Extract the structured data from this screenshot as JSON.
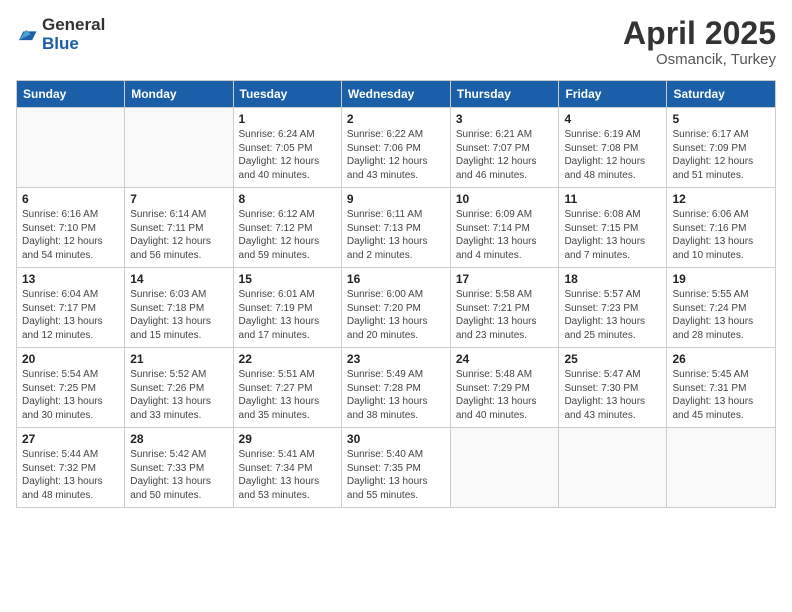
{
  "header": {
    "logo_general": "General",
    "logo_blue": "Blue",
    "title": "April 2025",
    "subtitle": "Osmancik, Turkey"
  },
  "days_of_week": [
    "Sunday",
    "Monday",
    "Tuesday",
    "Wednesday",
    "Thursday",
    "Friday",
    "Saturday"
  ],
  "weeks": [
    [
      {
        "day": "",
        "info": ""
      },
      {
        "day": "",
        "info": ""
      },
      {
        "day": "1",
        "info": "Sunrise: 6:24 AM\nSunset: 7:05 PM\nDaylight: 12 hours and 40 minutes."
      },
      {
        "day": "2",
        "info": "Sunrise: 6:22 AM\nSunset: 7:06 PM\nDaylight: 12 hours and 43 minutes."
      },
      {
        "day": "3",
        "info": "Sunrise: 6:21 AM\nSunset: 7:07 PM\nDaylight: 12 hours and 46 minutes."
      },
      {
        "day": "4",
        "info": "Sunrise: 6:19 AM\nSunset: 7:08 PM\nDaylight: 12 hours and 48 minutes."
      },
      {
        "day": "5",
        "info": "Sunrise: 6:17 AM\nSunset: 7:09 PM\nDaylight: 12 hours and 51 minutes."
      }
    ],
    [
      {
        "day": "6",
        "info": "Sunrise: 6:16 AM\nSunset: 7:10 PM\nDaylight: 12 hours and 54 minutes."
      },
      {
        "day": "7",
        "info": "Sunrise: 6:14 AM\nSunset: 7:11 PM\nDaylight: 12 hours and 56 minutes."
      },
      {
        "day": "8",
        "info": "Sunrise: 6:12 AM\nSunset: 7:12 PM\nDaylight: 12 hours and 59 minutes."
      },
      {
        "day": "9",
        "info": "Sunrise: 6:11 AM\nSunset: 7:13 PM\nDaylight: 13 hours and 2 minutes."
      },
      {
        "day": "10",
        "info": "Sunrise: 6:09 AM\nSunset: 7:14 PM\nDaylight: 13 hours and 4 minutes."
      },
      {
        "day": "11",
        "info": "Sunrise: 6:08 AM\nSunset: 7:15 PM\nDaylight: 13 hours and 7 minutes."
      },
      {
        "day": "12",
        "info": "Sunrise: 6:06 AM\nSunset: 7:16 PM\nDaylight: 13 hours and 10 minutes."
      }
    ],
    [
      {
        "day": "13",
        "info": "Sunrise: 6:04 AM\nSunset: 7:17 PM\nDaylight: 13 hours and 12 minutes."
      },
      {
        "day": "14",
        "info": "Sunrise: 6:03 AM\nSunset: 7:18 PM\nDaylight: 13 hours and 15 minutes."
      },
      {
        "day": "15",
        "info": "Sunrise: 6:01 AM\nSunset: 7:19 PM\nDaylight: 13 hours and 17 minutes."
      },
      {
        "day": "16",
        "info": "Sunrise: 6:00 AM\nSunset: 7:20 PM\nDaylight: 13 hours and 20 minutes."
      },
      {
        "day": "17",
        "info": "Sunrise: 5:58 AM\nSunset: 7:21 PM\nDaylight: 13 hours and 23 minutes."
      },
      {
        "day": "18",
        "info": "Sunrise: 5:57 AM\nSunset: 7:23 PM\nDaylight: 13 hours and 25 minutes."
      },
      {
        "day": "19",
        "info": "Sunrise: 5:55 AM\nSunset: 7:24 PM\nDaylight: 13 hours and 28 minutes."
      }
    ],
    [
      {
        "day": "20",
        "info": "Sunrise: 5:54 AM\nSunset: 7:25 PM\nDaylight: 13 hours and 30 minutes."
      },
      {
        "day": "21",
        "info": "Sunrise: 5:52 AM\nSunset: 7:26 PM\nDaylight: 13 hours and 33 minutes."
      },
      {
        "day": "22",
        "info": "Sunrise: 5:51 AM\nSunset: 7:27 PM\nDaylight: 13 hours and 35 minutes."
      },
      {
        "day": "23",
        "info": "Sunrise: 5:49 AM\nSunset: 7:28 PM\nDaylight: 13 hours and 38 minutes."
      },
      {
        "day": "24",
        "info": "Sunrise: 5:48 AM\nSunset: 7:29 PM\nDaylight: 13 hours and 40 minutes."
      },
      {
        "day": "25",
        "info": "Sunrise: 5:47 AM\nSunset: 7:30 PM\nDaylight: 13 hours and 43 minutes."
      },
      {
        "day": "26",
        "info": "Sunrise: 5:45 AM\nSunset: 7:31 PM\nDaylight: 13 hours and 45 minutes."
      }
    ],
    [
      {
        "day": "27",
        "info": "Sunrise: 5:44 AM\nSunset: 7:32 PM\nDaylight: 13 hours and 48 minutes."
      },
      {
        "day": "28",
        "info": "Sunrise: 5:42 AM\nSunset: 7:33 PM\nDaylight: 13 hours and 50 minutes."
      },
      {
        "day": "29",
        "info": "Sunrise: 5:41 AM\nSunset: 7:34 PM\nDaylight: 13 hours and 53 minutes."
      },
      {
        "day": "30",
        "info": "Sunrise: 5:40 AM\nSunset: 7:35 PM\nDaylight: 13 hours and 55 minutes."
      },
      {
        "day": "",
        "info": ""
      },
      {
        "day": "",
        "info": ""
      },
      {
        "day": "",
        "info": ""
      }
    ]
  ]
}
